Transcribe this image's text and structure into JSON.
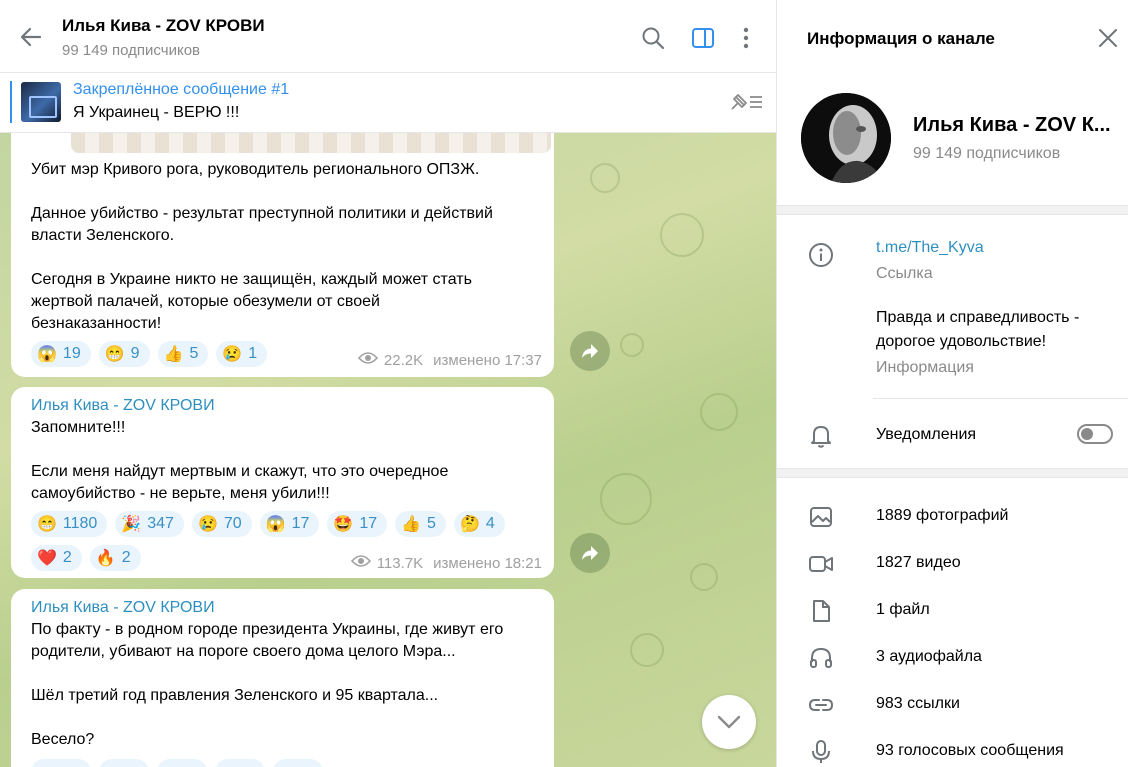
{
  "chat": {
    "title": "Илья Кива - ZOV КРОВИ",
    "subscribers": "99 149 подписчиков"
  },
  "pinned": {
    "title": "Закреплённое сообщение #1",
    "text": "Я Украинец - ВЕРЮ !!!"
  },
  "messages": [
    {
      "lines": [
        "Убит мэр Кривого рога, руководитель регионального ОПЗЖ.",
        "",
        "Данное убийство - результат преступной политики и действий",
        "власти Зеленского.",
        "",
        "Сегодня в Украине никто не защищён, каждый может стать",
        "жертвой палачей, которые обезумели от своей",
        "безнаказанности!"
      ],
      "reactions": [
        {
          "emoji": "😱",
          "count": "19"
        },
        {
          "emoji": "😁",
          "count": "9"
        },
        {
          "emoji": "👍",
          "count": "5"
        },
        {
          "emoji": "😢",
          "count": "1"
        }
      ],
      "views": "22.2K",
      "edited": "изменено 17:37"
    },
    {
      "sender": "Илья Кива - ZOV КРОВИ",
      "lines": [
        "Запомните!!!",
        "",
        "Если меня найдут мертвым и скажут, что это очередное",
        "самоубийство - не верьте, меня убили!!!"
      ],
      "reactions": [
        {
          "emoji": "😁",
          "count": "1180"
        },
        {
          "emoji": "🎉",
          "count": "347"
        },
        {
          "emoji": "😢",
          "count": "70"
        },
        {
          "emoji": "😱",
          "count": "17"
        },
        {
          "emoji": "🤩",
          "count": "17"
        },
        {
          "emoji": "👍",
          "count": "5"
        },
        {
          "emoji": "🤔",
          "count": "4"
        },
        {
          "emoji": "❤️",
          "count": "2"
        },
        {
          "emoji": "🔥",
          "count": "2"
        }
      ],
      "views": "113.7K",
      "edited": "изменено 18:21"
    },
    {
      "sender": "Илья Кива - ZOV КРОВИ",
      "lines": [
        "По факту - в родном городе президента Украины, где живут его",
        "родители,  убивают на пороге своего дома целого Мэра...",
        "",
        "Шёл третий год правления Зеленского и 95 квартала...",
        "",
        "Весело?"
      ]
    }
  ],
  "info": {
    "title": "Информация о канале",
    "name": "Илья Кива - ZOV К...",
    "subscribers": "99 149 подписчиков",
    "link": "t.me/The_Kyva",
    "link_label": "Ссылка",
    "description_line1": "Правда и справедливость -",
    "description_line2": "дорогое удовольствие!",
    "description_label": "Информация",
    "notifications": "Уведомления",
    "notifications_on": false,
    "media": [
      {
        "icon": "photo-icon",
        "label": "1889 фотографий"
      },
      {
        "icon": "video-icon",
        "label": "1827 видео"
      },
      {
        "icon": "file-icon",
        "label": "1 файл"
      },
      {
        "icon": "headphones-icon",
        "label": "3 аудиофайла"
      },
      {
        "icon": "link-icon",
        "label": "983 ссылки"
      },
      {
        "icon": "microphone-icon",
        "label": "93 голосовых сообщения"
      }
    ]
  },
  "colors": {
    "accent": "#3390ec",
    "link": "#2e8fbf",
    "reaction_bg": "#e9f4fc",
    "chat_bg": "#c3d5a2"
  }
}
